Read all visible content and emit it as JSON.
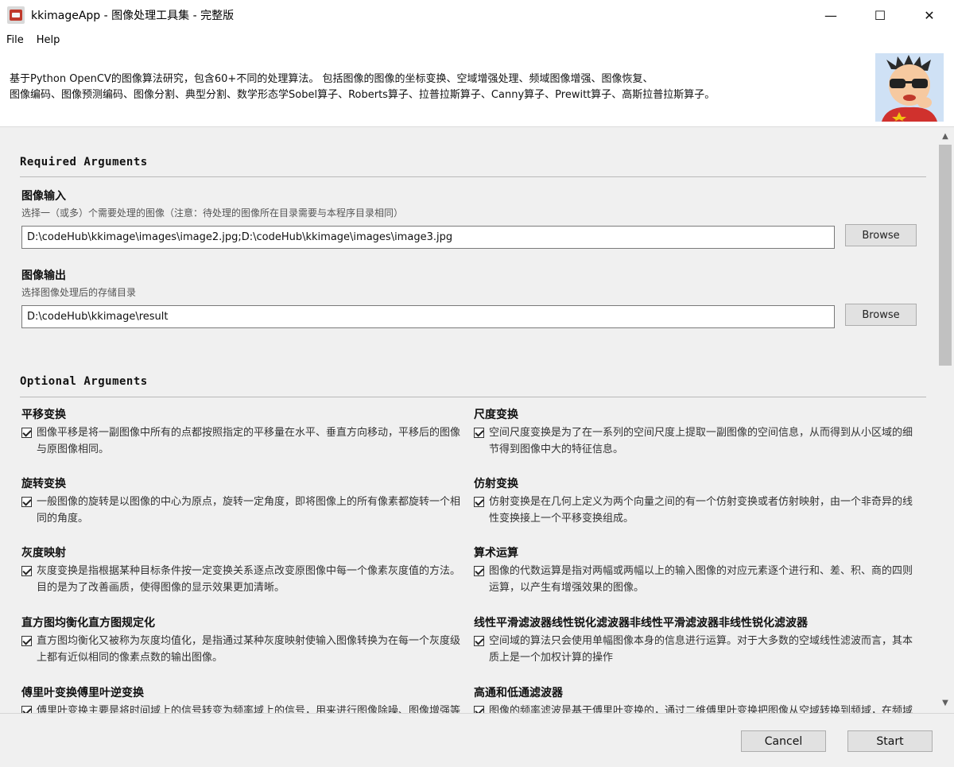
{
  "window": {
    "title": "kkimageApp - 图像处理工具集 - 完整版",
    "controls": {
      "minimize": "—",
      "maximize": "☐",
      "close": "✕"
    }
  },
  "menu": {
    "file": "File",
    "help": "Help"
  },
  "header": {
    "line1": "基于Python OpenCV的图像算法研究，包含60+不同的处理算法。 包括图像的图像的坐标变换、空域增强处理、频域图像增强、图像恢复、",
    "line2": "图像编码、图像预测编码、图像分割、典型分割、数学形态学Sobel算子、Roberts算子、拉普拉斯算子、Canny算子、Prewitt算子、高斯拉普拉斯算子。"
  },
  "required": {
    "title": "Required Arguments",
    "input": {
      "label": "图像输入",
      "help": "选择一（或多）个需要处理的图像（注意：待处理的图像所在目录需要与本程序目录相同）",
      "value": "D:\\codeHub\\kkimage\\images\\image2.jpg;D:\\codeHub\\kkimage\\images\\image3.jpg",
      "browse": "Browse"
    },
    "output": {
      "label": "图像输出",
      "help": "选择图像处理后的存储目录",
      "value": "D:\\codeHub\\kkimage\\result",
      "browse": "Browse"
    }
  },
  "optional": {
    "title": "Optional Arguments",
    "items": [
      {
        "title": "平移变换",
        "desc": "图像平移是将一副图像中所有的点都按照指定的平移量在水平、垂直方向移动，平移后的图像与原图像相同。",
        "checked": true
      },
      {
        "title": "尺度变换",
        "desc": "空间尺度变换是为了在一系列的空间尺度上提取一副图像的空间信息，从而得到从小区域的细节得到图像中大的特征信息。",
        "checked": true
      },
      {
        "title": "旋转变换",
        "desc": "一般图像的旋转是以图像的中心为原点，旋转一定角度，即将图像上的所有像素都旋转一个相同的角度。",
        "checked": true
      },
      {
        "title": "仿射变换",
        "desc": "仿射变换是在几何上定义为两个向量之间的有一个仿射变换或者仿射映射，由一个非奇异的线性变换接上一个平移变换组成。",
        "checked": true
      },
      {
        "title": "灰度映射",
        "desc": "灰度变换是指根据某种目标条件按一定变换关系逐点改变原图像中每一个像素灰度值的方法。目的是为了改善画质，使得图像的显示效果更加清晰。",
        "checked": true
      },
      {
        "title": "算术运算",
        "desc": "图像的代数运算是指对两幅或两幅以上的输入图像的对应元素逐个进行和、差、积、商的四则运算，以产生有增强效果的图像。",
        "checked": true
      },
      {
        "title": "直方图均衡化直方图规定化",
        "desc": "直方图均衡化又被称为灰度均值化，是指通过某种灰度映射使输入图像转换为在每一个灰度级上都有近似相同的像素点数的输出图像。",
        "checked": true
      },
      {
        "title": "线性平滑滤波器线性锐化滤波器非线性平滑滤波器非线性锐化滤波器",
        "desc": "空间域的算法只会使用单幅图像本身的信息进行运算。对于大多数的空域线性滤波而言，其本质上是一个加权计算的操作",
        "checked": true
      },
      {
        "title": "傅里叶变换傅里叶逆变换",
        "desc": "傅里叶变换主要是将时间域上的信号转变为频率域上的信号，用来进行图像除噪、图像增强等处理。",
        "checked": true
      },
      {
        "title": "高通和低通滤波器",
        "desc": "图像的频率滤波是基于傅里叶变换的，通过二维傅里叶变换把图像从空域转换到频域，在频域中对图像进行处理。",
        "checked": true
      }
    ]
  },
  "footer": {
    "cancel": "Cancel",
    "start": "Start"
  }
}
